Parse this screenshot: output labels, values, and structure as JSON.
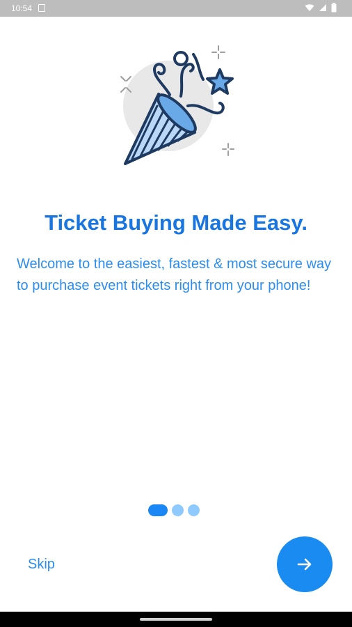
{
  "status_bar": {
    "time": "10:54"
  },
  "onboarding": {
    "title": "Ticket Buying Made Easy.",
    "description": "Welcome to the easiest, fastest & most secure way to purchase event tickets right from your phone!",
    "current_page": 1,
    "total_pages": 3
  },
  "actions": {
    "skip_label": "Skip",
    "next_icon": "arrow-right-icon"
  },
  "colors": {
    "accent": "#1a87f4",
    "title": "#1976e0",
    "text": "#2b8df0",
    "inactive_dot": "#8fcaff"
  }
}
